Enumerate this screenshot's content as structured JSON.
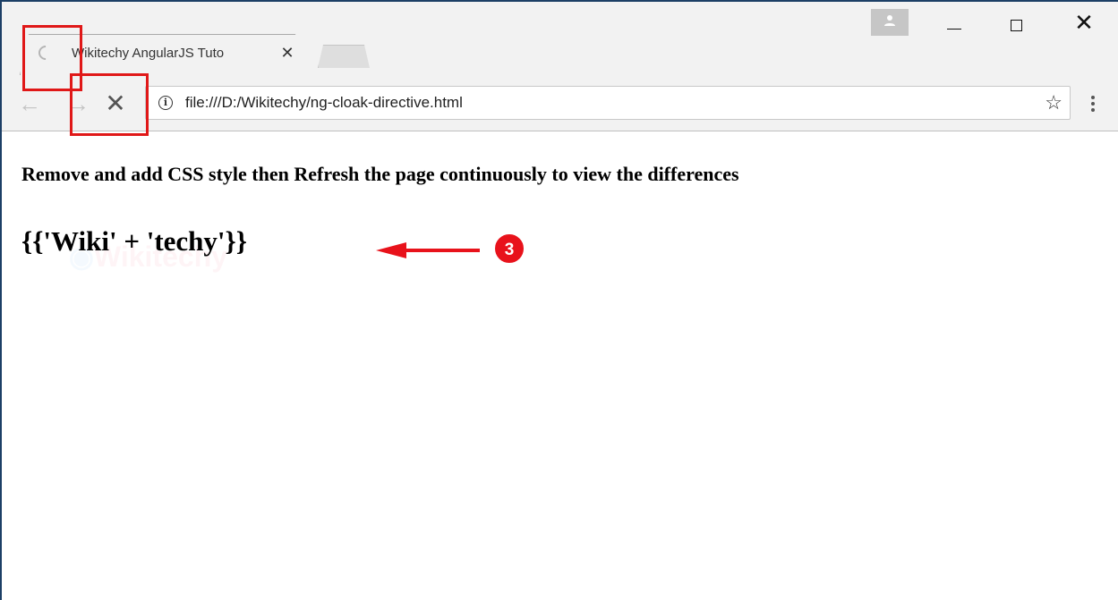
{
  "browser": {
    "tab": {
      "title": "Wikitechy AngularJS Tuto"
    },
    "tab_close_glyph": "✕",
    "address_bar": {
      "url": "file:///D:/Wikitechy/ng-cloak-directive.html"
    },
    "nav": {
      "back_glyph": "←",
      "forward_glyph": "→",
      "stop_glyph": "✕"
    },
    "bookmark_glyph": "☆",
    "window_controls": {
      "close_glyph": "✕"
    },
    "icons": [
      "loading-spinner-icon",
      "info-icon",
      "star-icon",
      "menu-icon",
      "profile-icon"
    ]
  },
  "page": {
    "heading": "Remove and add CSS style then Refresh the page continuously to view the differences",
    "expression": "{{'Wiki' + 'techy'}}",
    "watermark_text": "Wikitechy"
  },
  "annotations": {
    "step_number": "3",
    "highlight_color": "#e01818",
    "arrow_color": "#e8121b"
  }
}
